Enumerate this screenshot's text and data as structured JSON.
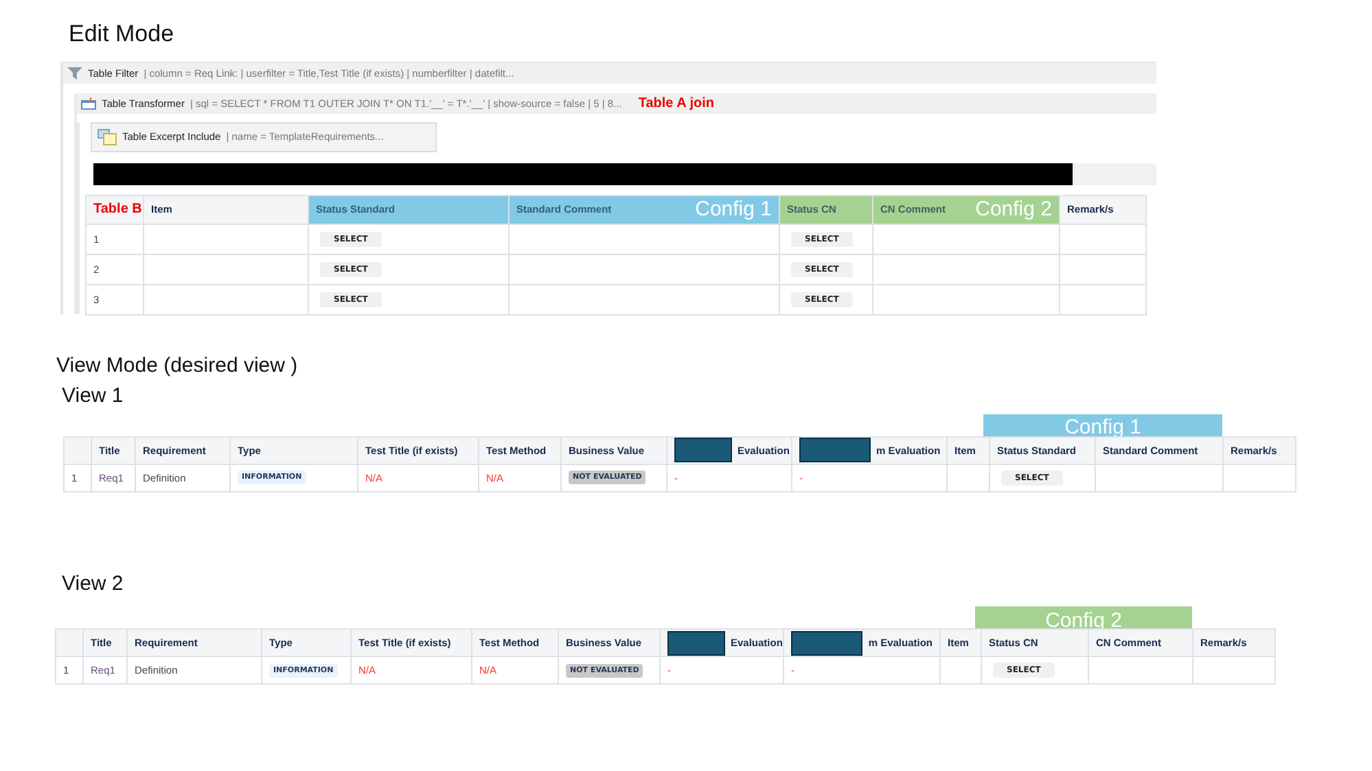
{
  "edit_mode": {
    "heading": "Edit Mode",
    "macros": [
      {
        "kind": "filter",
        "name": "Table Filter",
        "params": "| column = Req Link: | userfilter = Title,Test Title (if exists) | numberfilter | datefilt..."
      },
      {
        "kind": "transformer",
        "name": "Table Transformer",
        "params": "| sql = SELECT * FROM T1 OUTER JOIN T* ON T1.'__' = T*.'__' | show-source = false | 5 | 8...",
        "note": "Table A join"
      },
      {
        "kind": "excerpt",
        "name": "Table Excerpt Include",
        "params": "| name = TemplateRequirements..."
      }
    ],
    "title_redacted": true,
    "table": {
      "label": "Table B",
      "columns": [
        {},
        {
          "label": "Item"
        },
        {
          "group": "Config 1",
          "color": "#82c9e6",
          "columns": [
            {
              "label": "Status Standard"
            },
            {
              "label": "Standard Comment"
            }
          ]
        },
        {
          "group": "Config 2",
          "color": "#a4d290",
          "columns": [
            {
              "label": "Status CN"
            },
            {
              "label": "CN Comment"
            }
          ]
        },
        {
          "label": "Remark/s"
        }
      ],
      "rows": [
        {
          "cells": [
            {
              "kind": "text",
              "text": "1"
            },
            {
              "kind": "empty"
            },
            {
              "kind": "select",
              "text": "SELECT"
            },
            {
              "kind": "empty"
            },
            {
              "kind": "select",
              "text": "SELECT"
            },
            {
              "kind": "empty"
            },
            {
              "kind": "empty"
            }
          ]
        },
        {
          "cells": [
            {
              "kind": "text",
              "text": "2"
            },
            {
              "kind": "empty"
            },
            {
              "kind": "select",
              "text": "SELECT"
            },
            {
              "kind": "empty"
            },
            {
              "kind": "select",
              "text": "SELECT"
            },
            {
              "kind": "empty"
            },
            {
              "kind": "empty"
            }
          ]
        },
        {
          "cells": [
            {
              "kind": "text",
              "text": "3"
            },
            {
              "kind": "empty"
            },
            {
              "kind": "select",
              "text": "SELECT"
            },
            {
              "kind": "empty"
            },
            {
              "kind": "select",
              "text": "SELECT"
            },
            {
              "kind": "empty"
            },
            {
              "kind": "empty"
            }
          ]
        }
      ]
    }
  },
  "view_mode": {
    "heading": "View Mode (desired view )",
    "views": [
      {
        "title": "View 1",
        "columns": [
          {},
          {
            "label": "Title"
          },
          {
            "label": "Requirement"
          },
          {
            "label": "Type"
          },
          {
            "label": "Test Title (if exists)"
          },
          {
            "label": "Test Method"
          },
          {
            "label": "Business Value"
          },
          {
            "label": "Evaluation",
            "redacted": true
          },
          {
            "label": "m Evaluation",
            "redacted": true
          },
          {
            "label": "Item"
          },
          {
            "group": "Config 1",
            "color": "#82c9e6",
            "columns": [
              {
                "label": "Status Standard"
              },
              {
                "label": "Standard Comment"
              }
            ]
          },
          {
            "label": "Remark/s"
          }
        ],
        "rows": [
          {
            "cells": [
              {
                "kind": "text",
                "text": "1"
              },
              {
                "kind": "link",
                "text": "Req1"
              },
              {
                "kind": "text",
                "text": "Definition"
              },
              {
                "kind": "badge",
                "text": "INFORMATION"
              },
              {
                "kind": "error",
                "text": "N/A"
              },
              {
                "kind": "error",
                "text": "N/A"
              },
              {
                "kind": "status",
                "text": "NOT EVALUATED"
              },
              {
                "kind": "error",
                "text": "-"
              },
              {
                "kind": "error",
                "text": "-"
              },
              {
                "kind": "empty"
              },
              {
                "kind": "select",
                "text": "SELECT"
              },
              {
                "kind": "empty"
              },
              {
                "kind": "empty"
              }
            ]
          }
        ]
      },
      {
        "title": "View 2",
        "columns": [
          {},
          {
            "label": "Title"
          },
          {
            "label": "Requirement"
          },
          {
            "label": "Type"
          },
          {
            "label": "Test Title (if exists)"
          },
          {
            "label": "Test Method"
          },
          {
            "label": "Business Value"
          },
          {
            "label": "Evaluation",
            "redacted": true
          },
          {
            "label": "m Evaluation",
            "redacted": true
          },
          {
            "label": "Item"
          },
          {
            "group": "Config 2",
            "color": "#a4d290",
            "columns": [
              {
                "label": "Status CN"
              },
              {
                "label": "CN Comment"
              }
            ]
          },
          {
            "label": "Remark/s"
          }
        ],
        "rows": [
          {
            "cells": [
              {
                "kind": "text",
                "text": "1"
              },
              {
                "kind": "link",
                "text": "Req1"
              },
              {
                "kind": "text",
                "text": "Definition"
              },
              {
                "kind": "badge",
                "text": "INFORMATION"
              },
              {
                "kind": "error",
                "text": "N/A"
              },
              {
                "kind": "error",
                "text": "N/A"
              },
              {
                "kind": "status",
                "text": "NOT EVALUATED"
              },
              {
                "kind": "error",
                "text": "-"
              },
              {
                "kind": "error",
                "text": "-"
              },
              {
                "kind": "empty"
              },
              {
                "kind": "select",
                "text": "SELECT"
              },
              {
                "kind": "empty"
              },
              {
                "kind": "empty"
              }
            ]
          }
        ]
      }
    ]
  }
}
